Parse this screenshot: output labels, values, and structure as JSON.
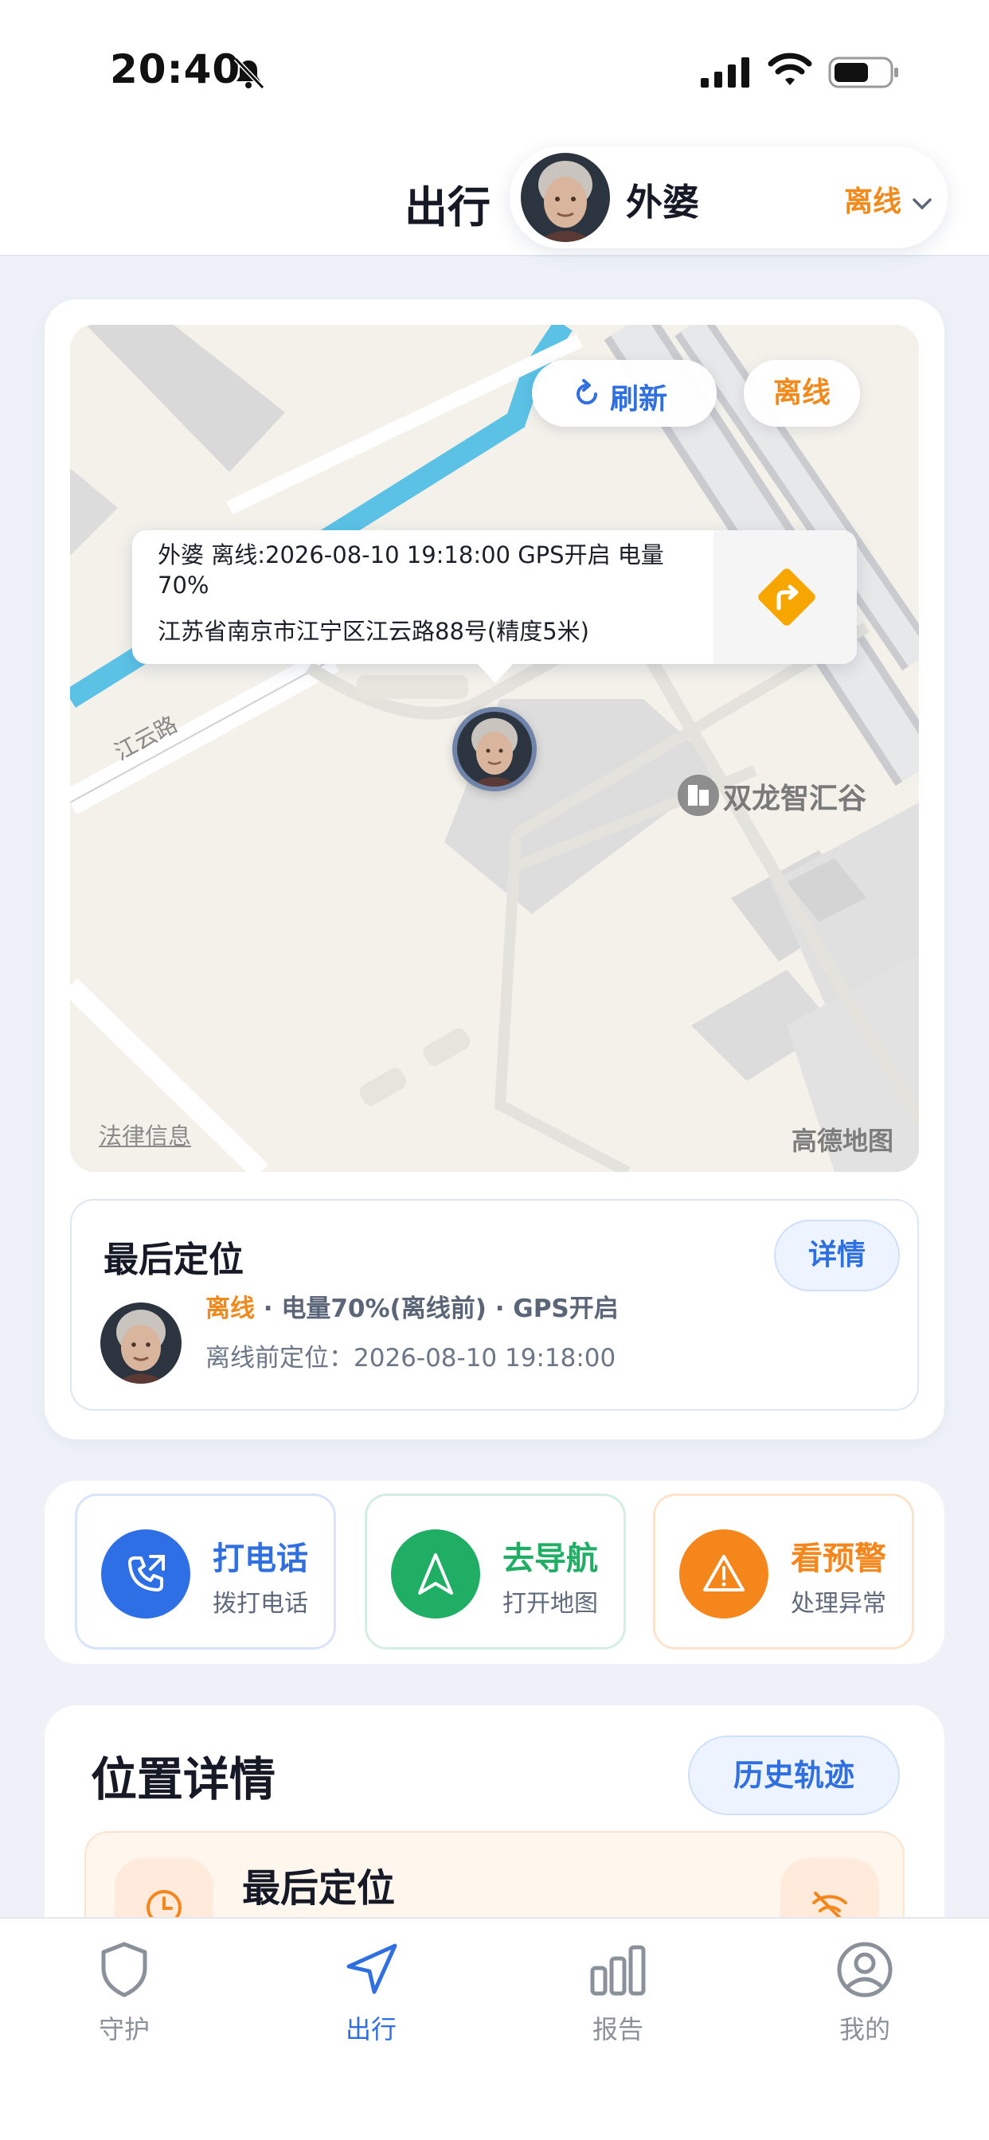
{
  "status_bar": {
    "time": "20:40",
    "icons": [
      "bell-slash-icon",
      "signal-icon",
      "wifi-icon",
      "battery-icon"
    ]
  },
  "header": {
    "title": "出行",
    "person": {
      "name": "外婆",
      "status": "离线"
    }
  },
  "map": {
    "refresh_label": "刷新",
    "status_pill": "离线",
    "popup": {
      "line1": "外婆 离线:2026-08-10 19:18:00 GPS开启 电量70%",
      "line2": "江苏省南京市江宁区江云路88号(精度5米)"
    },
    "poi_label": "双龙智汇谷",
    "road_label": "江云路",
    "legal_link": "法律信息",
    "provider_logo": "高德地图"
  },
  "last_location": {
    "title": "最后定位",
    "detail_button": "详情",
    "status_offline": "离线",
    "status_rest": " · 电量70%(离线前) · GPS开启",
    "time_text": "离线前定位：2026-08-10 19:18:00"
  },
  "actions": [
    {
      "title": "打电话",
      "subtitle": "拨打电话",
      "icon": "phone-icon"
    },
    {
      "title": "去导航",
      "subtitle": "打开地图",
      "icon": "navigation-arrow-icon"
    },
    {
      "title": "看预警",
      "subtitle": "处理异常",
      "icon": "warning-icon"
    }
  ],
  "location_details": {
    "title": "位置详情",
    "history_button": "历史轨迹",
    "inner_title": "最后定位"
  },
  "tabs": [
    {
      "label": "守护",
      "icon": "shield-icon",
      "active": false
    },
    {
      "label": "出行",
      "icon": "navigation-icon",
      "active": true
    },
    {
      "label": "报告",
      "icon": "bar-chart-icon",
      "active": false
    },
    {
      "label": "我的",
      "icon": "profile-icon",
      "active": false
    }
  ],
  "colors": {
    "primary": "#2f6fe0",
    "offline": "#f08a1c",
    "call": "#2f6fe6",
    "navigate": "#1fae63",
    "warning": "#f5861b"
  }
}
